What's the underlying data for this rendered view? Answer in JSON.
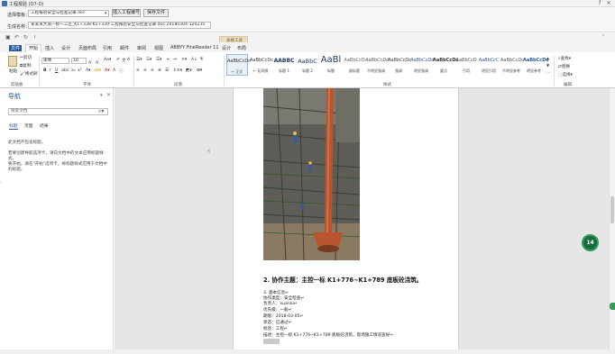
{
  "window": {
    "title": "工程报验 (O7-O)"
  },
  "form": {
    "template_label": "选择模板：",
    "template_value": "工程报验安全与检查记录.doc",
    "insert_button": "插入工程编号",
    "save_button": "保存文件",
    "filename_label": "生成名称：",
    "filename_value": "某某某大道一标一工区_K1+338-K1+339-工程报验安全与检查记录.doc-20180304-120235"
  },
  "tabs": [
    "文件",
    "开始",
    "插入",
    "设计",
    "页面布局",
    "引用",
    "邮件",
    "审阅",
    "视图",
    "ABBYY FineReader 11",
    "设计",
    "布局"
  ],
  "context_tab_header": "表格工具",
  "ribbon": {
    "paste_label": "粘贴",
    "cut_label": "剪切",
    "copy_label": "复制",
    "format_painter_label": "格式刷",
    "font_name": "宋体",
    "font_size": "10",
    "groups": [
      "剪贴板",
      "字体",
      "段落",
      "样式",
      "编辑"
    ],
    "styles": [
      {
        "preview": "AaBbCcDc",
        "name": "↵ 正文"
      },
      {
        "preview": "AaBbCcDc",
        "name": "↵ 无间隔"
      },
      {
        "preview": "AABBC",
        "name": "标题 1"
      },
      {
        "preview": "AaBbC",
        "name": "标题 2"
      },
      {
        "preview": "AaBl",
        "name": "标题"
      },
      {
        "preview": "AaBbCcD",
        "name": "副标题"
      },
      {
        "preview": "AaBbCcDd",
        "name": "不明显强调"
      },
      {
        "preview": "AaBbCcDc",
        "name": "强调"
      },
      {
        "preview": "AaBbCcDd",
        "name": "明显强调"
      },
      {
        "preview": "AaBbCcDc",
        "name": "要点"
      },
      {
        "preview": "AaBbCcD",
        "name": "引用"
      },
      {
        "preview": "AaBbCcC",
        "name": "明显引用"
      },
      {
        "preview": "AaBbCcDc",
        "name": "不明显参考"
      },
      {
        "preview": "AaBbCcDc",
        "name": "明显参考"
      }
    ],
    "find_label": "查找",
    "replace_label": "替换",
    "select_label": "选择"
  },
  "nav": {
    "title": "导航",
    "search_placeholder": "搜索文档",
    "tabs": [
      "标题",
      "页面",
      "结果"
    ],
    "msg1": "此文档不包含标题。",
    "msg2": "若要创建导航选项卡，请向文档中的文本应用标题样式。",
    "msg3": "要开始，请在\"开始\"选项卡，将标题样式应用于文档中的标题。"
  },
  "document": {
    "heading": "2. 协作主题：主控一标 K1+776~K1+789 底板砼浇筑。",
    "lines": [
      "3. 基本信息↵",
      "协作类型：安全检查↵",
      "负责人：xuanlu↵",
      "优先级：一般↵",
      "期限：2018-03-05↵",
      "状态：已通过↵",
      "标签：工程↵",
      "描述：主控一标 K1+776~K1+789 底板砼浇筑，现场施工情况良好↵"
    ]
  },
  "badge": {
    "count": "14"
  },
  "colors": {
    "accent": "#2b579a",
    "badge": "#1a6b3e"
  }
}
